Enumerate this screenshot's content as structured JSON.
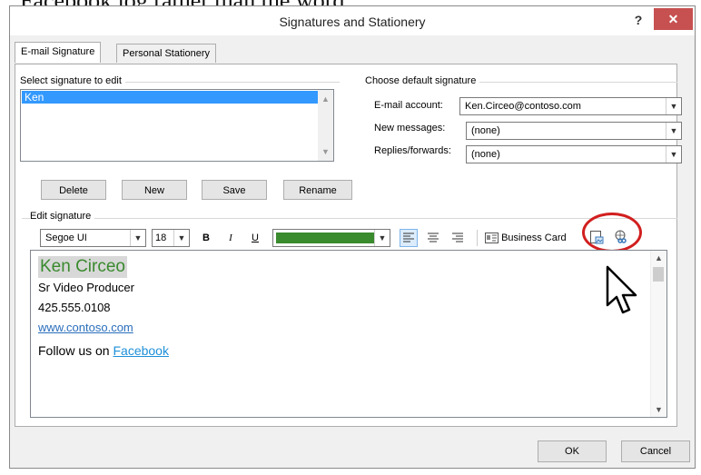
{
  "caption": "Facebook log rather than the word.",
  "window": {
    "title": "Signatures and Stationery",
    "help": "?",
    "close": "✕"
  },
  "tabs": [
    {
      "label": "E-mail Signature",
      "active": true
    },
    {
      "label": "Personal Stationery",
      "active": false
    }
  ],
  "select_signature": {
    "label": "Select signature to edit",
    "items": [
      "Ken"
    ],
    "selected": "Ken",
    "buttons": {
      "delete": "Delete",
      "new": "New",
      "save": "Save",
      "rename": "Rename"
    }
  },
  "default_signature": {
    "label": "Choose default signature",
    "email_account_label": "E-mail account:",
    "email_account_value": "Ken.Circeo@contoso.com",
    "new_messages_label": "New messages:",
    "new_messages_value": "(none)",
    "replies_label": "Replies/forwards:",
    "replies_value": "(none)"
  },
  "edit_signature": {
    "label": "Edit signature",
    "font": "Segoe UI",
    "size": "18",
    "bold": "B",
    "italic": "I",
    "underline": "U",
    "font_color": "#3a8a2e",
    "business_card": "Business Card"
  },
  "signature": {
    "name": "Ken Circeo",
    "job_title": "Sr Video Producer",
    "phone": "425.555.0108",
    "website": "www.contoso.com",
    "follow_text": "Follow us on ",
    "follow_link": "Facebook"
  },
  "footer": {
    "ok": "OK",
    "cancel": "Cancel"
  },
  "colors": {
    "selection": "#3399ff",
    "close": "#c75050",
    "highlight_circle": "#d21f1f"
  }
}
